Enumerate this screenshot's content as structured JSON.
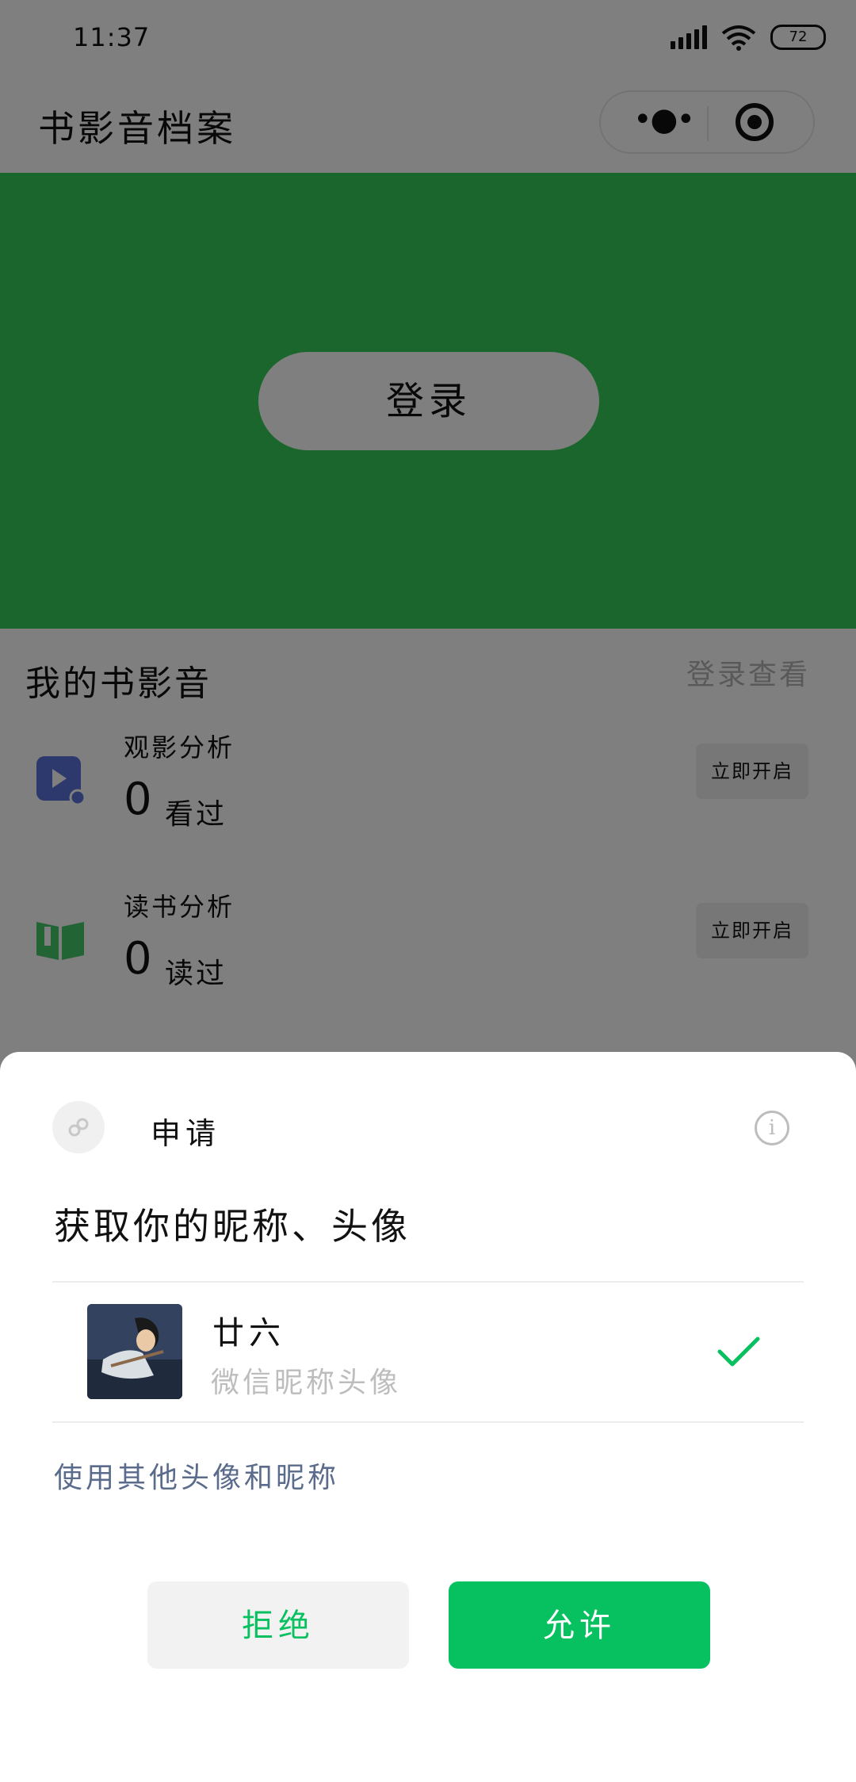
{
  "status_bar": {
    "time": "11:37",
    "battery": "72"
  },
  "navbar": {
    "title": "书影音档案",
    "more_label": "•●•"
  },
  "hero": {
    "login_label": "登录"
  },
  "section": {
    "title": "我的书影音",
    "link": "登录查看"
  },
  "rows": [
    {
      "label": "观影分析",
      "count": "0",
      "unit": "看过",
      "button": "立即开启",
      "icon": "play-icon"
    },
    {
      "label": "读书分析",
      "count": "0",
      "unit": "读过",
      "button": "立即开启",
      "icon": "book-icon"
    }
  ],
  "sheet": {
    "title": "申请",
    "info_icon": "i",
    "description": "获取你的昵称、头像",
    "user": {
      "name": "廿六",
      "subtitle": "微信昵称头像"
    },
    "other_link": "使用其他头像和昵称",
    "reject_label": "拒绝",
    "allow_label": "允许"
  },
  "colors": {
    "hero_green": "#37cd5b",
    "wechat_green": "#07c160",
    "link_blue": "#5a6b8c"
  }
}
